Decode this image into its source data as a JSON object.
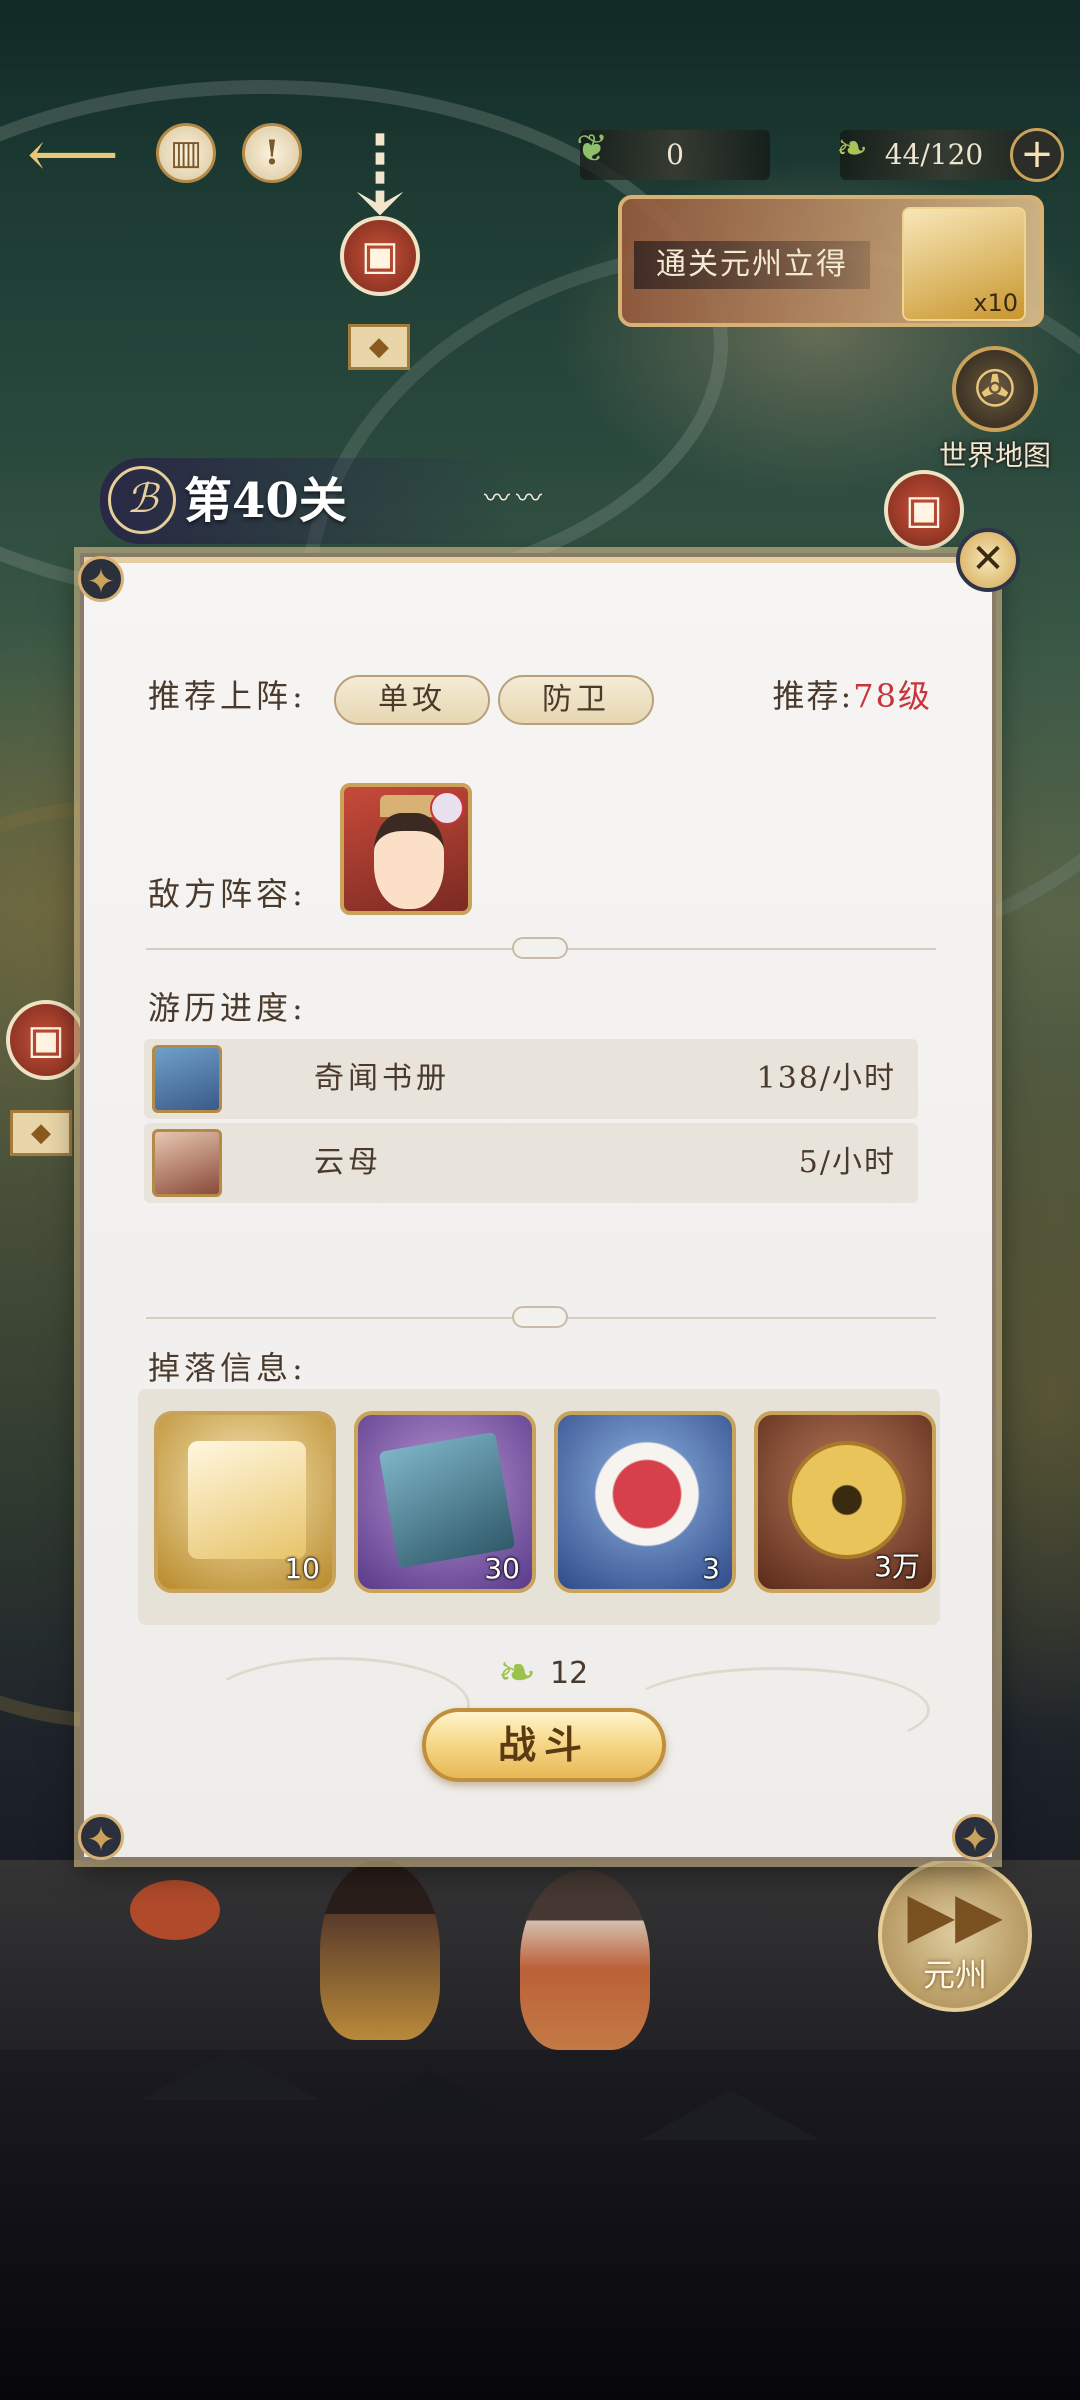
{
  "hud": {
    "back_icon": "back-arrow-icon",
    "scroll_icon": "scroll-icon",
    "info_icon": "info-icon",
    "info_glyph": "!",
    "resource_a_value": "0",
    "stamina_value": "44/120",
    "plus_glyph": "+",
    "quest_text": "通关元州立得",
    "quest_reward_count": "x10",
    "world_map_label": "世界地图",
    "next_area_label": "元州"
  },
  "stage": {
    "title": "第40关"
  },
  "panel": {
    "recommend_label": "推荐上阵:",
    "recommend_tags": [
      "单攻",
      "防卫"
    ],
    "recommend_level_prefix": "推荐:",
    "recommend_level_value": "78级",
    "enemy_label": "敌方阵容:",
    "travel_progress_label": "游历进度:",
    "progress_items": [
      {
        "name": "奇闻书册",
        "rate": "138/小时",
        "icon": "book-icon"
      },
      {
        "name": "云母",
        "rate": "5/小时",
        "icon": "mica-icon"
      }
    ],
    "drops_label": "掉落信息:",
    "drops": [
      {
        "icon": "gold-ticket-icon",
        "count": "10",
        "frame": "gold"
      },
      {
        "icon": "purple-book-icon",
        "count": "30",
        "frame": "purple"
      },
      {
        "icon": "dessert-bowl-icon",
        "count": "3",
        "frame": "blue"
      },
      {
        "icon": "copper-coin-icon",
        "count": "3万",
        "frame": "bronze"
      }
    ],
    "cost_value": "12",
    "battle_label": "战斗"
  },
  "colors": {
    "accent_red": "#c8343a",
    "gold": "#c9a35a",
    "panel_bg": "#f1efed",
    "text_brown": "#4a3a2c"
  }
}
